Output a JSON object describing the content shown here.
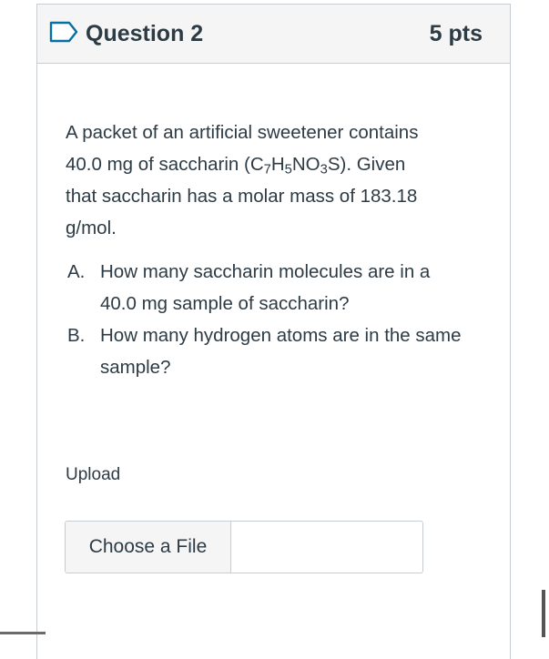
{
  "question": {
    "title": "Question 2",
    "points": "5 pts",
    "flag_icon": "bookmark-flag-icon",
    "prompt": {
      "line1": "A packet of an artificial sweetener contains",
      "line2_a": "40.0 mg of saccharin (C",
      "sub1": "7",
      "h": "H",
      "sub2": "5",
      "no": "NO",
      "sub3": "3",
      "line2_b": "S). Given",
      "line3": "that saccharin has a molar mass of 183.18",
      "line4": "g/mol."
    },
    "parts": [
      {
        "letter": "A.",
        "text": "How many saccharin molecules are in a 40.0 mg sample of saccharin?"
      },
      {
        "letter": "B.",
        "text": "How many hydrogen atoms are in the same sample?"
      }
    ]
  },
  "upload": {
    "label": "Upload",
    "button_label": "Choose a File"
  },
  "colors": {
    "text": "#2d3b45",
    "header_bg": "#f5f5f5",
    "border": "#c7cdd1",
    "flag_accent": "#0770a3"
  }
}
